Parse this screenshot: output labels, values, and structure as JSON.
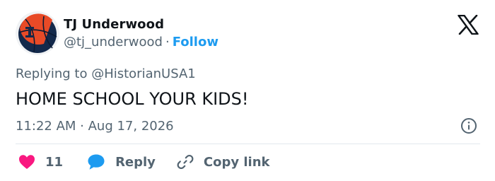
{
  "author": {
    "name": "TJ Underwood",
    "handle": "@tj_underwood",
    "separator": "·",
    "follow_label": "Follow"
  },
  "tweet": {
    "replying_to": "Replying to @HistorianUSA1",
    "text": "HOME SCHOOL YOUR KIDS!",
    "timestamp": "11:22 AM · Aug 17, 2026"
  },
  "actions": {
    "like_count": "11",
    "reply_label": "Reply",
    "copy_label": "Copy link"
  },
  "colors": {
    "accent": "#1d9bf0",
    "like": "#f91880",
    "reply_icon": "#1d9bf0",
    "muted": "#536471",
    "text": "#0f1419"
  },
  "icons": {
    "avatar": "basketball-avatar",
    "brand": "x-logo-icon",
    "info": "info-icon",
    "like": "heart-icon",
    "reply": "speech-bubble-icon",
    "copy": "link-icon"
  }
}
